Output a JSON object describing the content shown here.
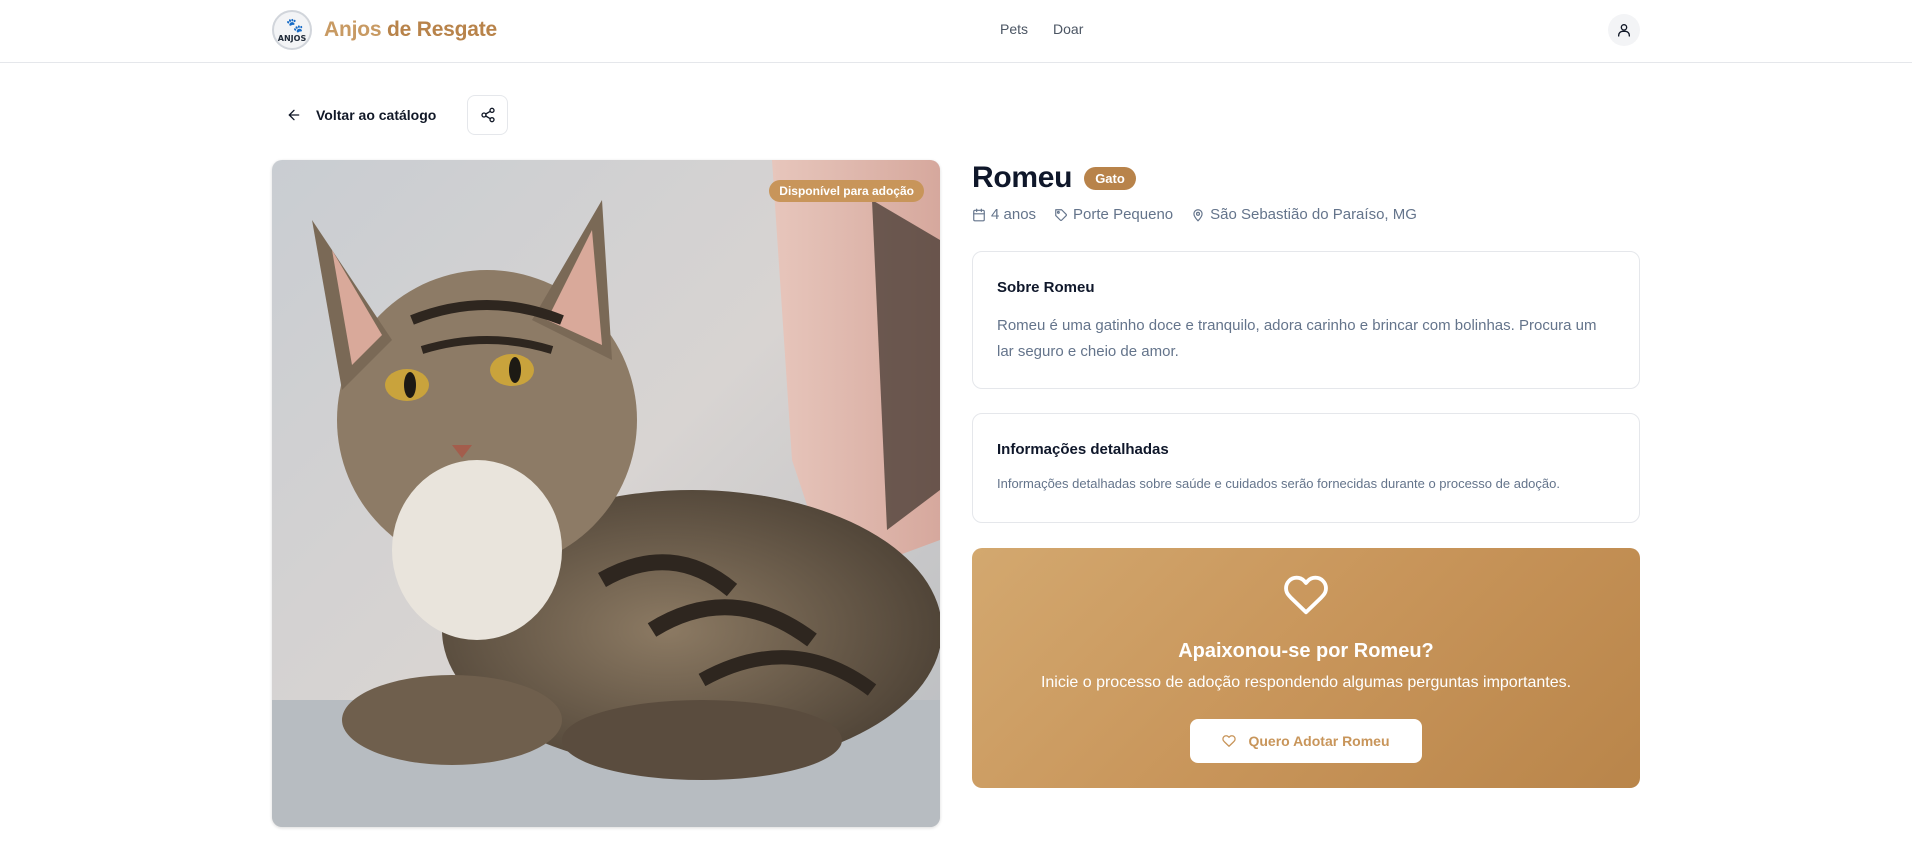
{
  "header": {
    "brand_part1": "Anjos",
    "brand_part2": "de Resgate",
    "logo_text": "ANJOS",
    "nav": [
      {
        "label": "Pets"
      },
      {
        "label": "Doar"
      }
    ]
  },
  "actions": {
    "back_label": "Voltar ao catálogo"
  },
  "photo": {
    "status_badge": "Disponível para adoção"
  },
  "pet": {
    "name": "Romeu",
    "type": "Gato",
    "age": "4 anos",
    "size": "Porte Pequeno",
    "location": "São Sebastião do Paraíso, MG"
  },
  "about": {
    "title": "Sobre Romeu",
    "text": "Romeu é uma gatinho doce e tranquilo, adora carinho e brincar com bolinhas. Procura um lar seguro e cheio de amor."
  },
  "info": {
    "title": "Informações detalhadas",
    "text": "Informações detalhadas sobre saúde e cuidados serão fornecidas durante o processo de adoção."
  },
  "cta": {
    "title": "Apaixonou-se por Romeu?",
    "subtitle": "Inicie o processo de adoção respondendo algumas perguntas importantes.",
    "button_label": "Quero Adotar Romeu"
  },
  "colors": {
    "brand": "#c89a63",
    "accent": "#c8955a",
    "badge": "#b8834a",
    "muted_text": "#64748b"
  },
  "icons": {
    "user": "user-icon",
    "back": "arrow-left-icon",
    "share": "share-icon",
    "calendar": "calendar-icon",
    "tag": "tag-icon",
    "location": "map-pin-icon",
    "heart": "heart-icon"
  }
}
